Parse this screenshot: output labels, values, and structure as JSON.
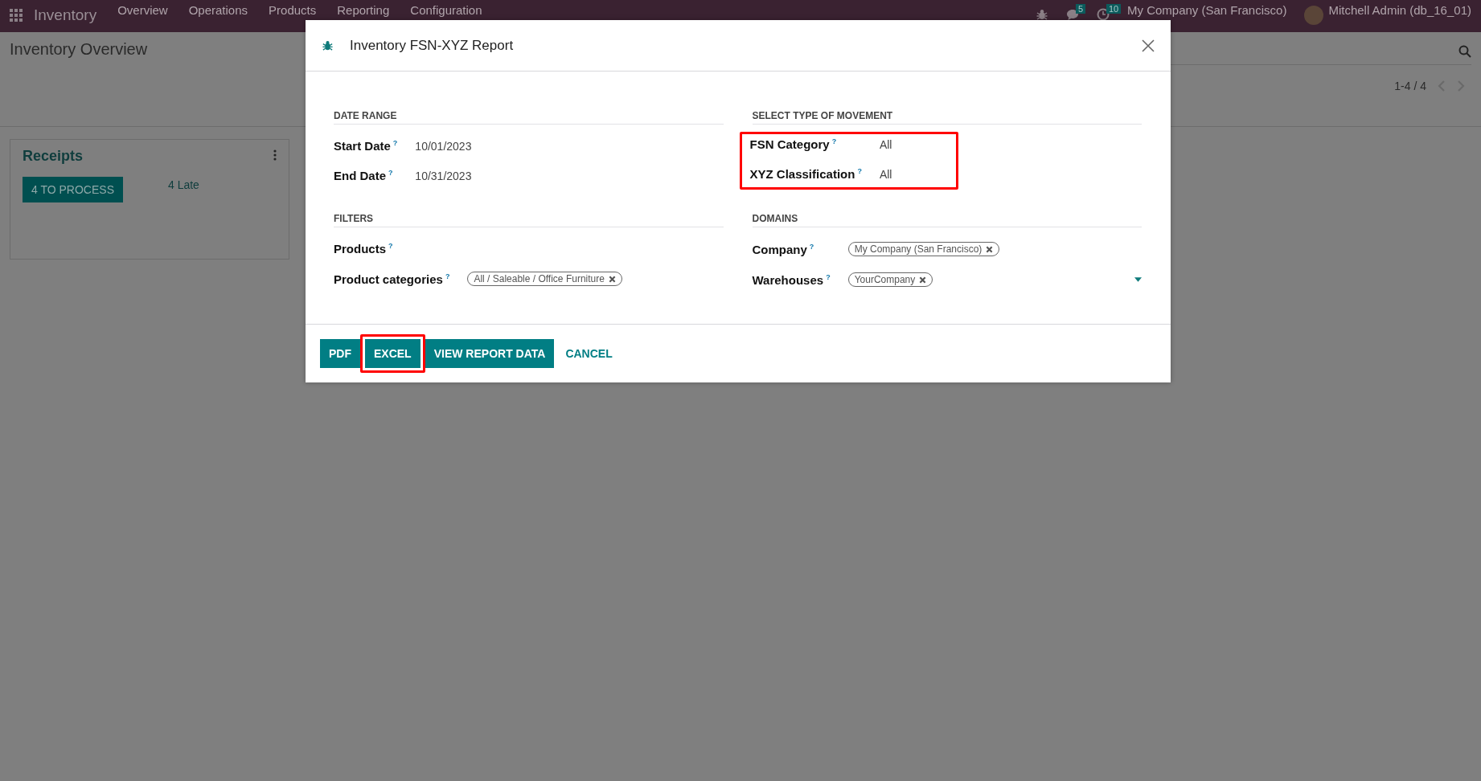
{
  "navbar": {
    "app_name": "Inventory",
    "menu": [
      "Overview",
      "Operations",
      "Products",
      "Reporting",
      "Configuration"
    ],
    "messages_count": "5",
    "activities_count": "10",
    "company": "My Company (San Francisco)",
    "user": "Mitchell Admin (db_16_01)"
  },
  "page": {
    "title": "Inventory Overview",
    "pager": "1-4 / 4"
  },
  "card": {
    "title": "Receipts",
    "process_button": "4 TO PROCESS",
    "late_link": "4 Late"
  },
  "dialog": {
    "title": "Inventory FSN-XYZ Report",
    "sections": [
      {
        "heading": "DATE RANGE",
        "highlighted": false,
        "fields": [
          {
            "label": "Start Date",
            "help": "?",
            "kind": "text",
            "value": "10/01/2023"
          },
          {
            "label": "End Date",
            "help": "?",
            "kind": "text",
            "value": "10/31/2023"
          }
        ]
      },
      {
        "heading": "SELECT TYPE OF MOVEMENT",
        "highlighted": true,
        "fields": [
          {
            "label": "FSN Category",
            "help": "?",
            "kind": "text",
            "value": "All"
          },
          {
            "label": "XYZ Classification",
            "help": "?",
            "kind": "text",
            "value": "All"
          }
        ]
      },
      {
        "heading": "FILTERS",
        "highlighted": false,
        "fields": [
          {
            "label": "Products",
            "help": "?",
            "kind": "empty"
          },
          {
            "label": "Product categories",
            "help": "?",
            "kind": "tags",
            "tags": [
              "All / Saleable / Office Furniture"
            ]
          }
        ]
      },
      {
        "heading": "DOMAINS",
        "highlighted": false,
        "fields": [
          {
            "label": "Company",
            "help": "?",
            "kind": "tags",
            "tags": [
              "My Company (San Francisco)"
            ]
          },
          {
            "label": "Warehouses",
            "help": "?",
            "kind": "tags",
            "tags": [
              "YourCompany"
            ],
            "dropdown": true
          }
        ]
      }
    ],
    "buttons": [
      {
        "label": "PDF",
        "kind": "primary",
        "highlighted": false
      },
      {
        "label": "EXCEL",
        "kind": "primary",
        "highlighted": true
      },
      {
        "label": "VIEW REPORT DATA",
        "kind": "primary",
        "highlighted": false
      },
      {
        "label": "CANCEL",
        "kind": "link",
        "highlighted": false
      }
    ]
  }
}
